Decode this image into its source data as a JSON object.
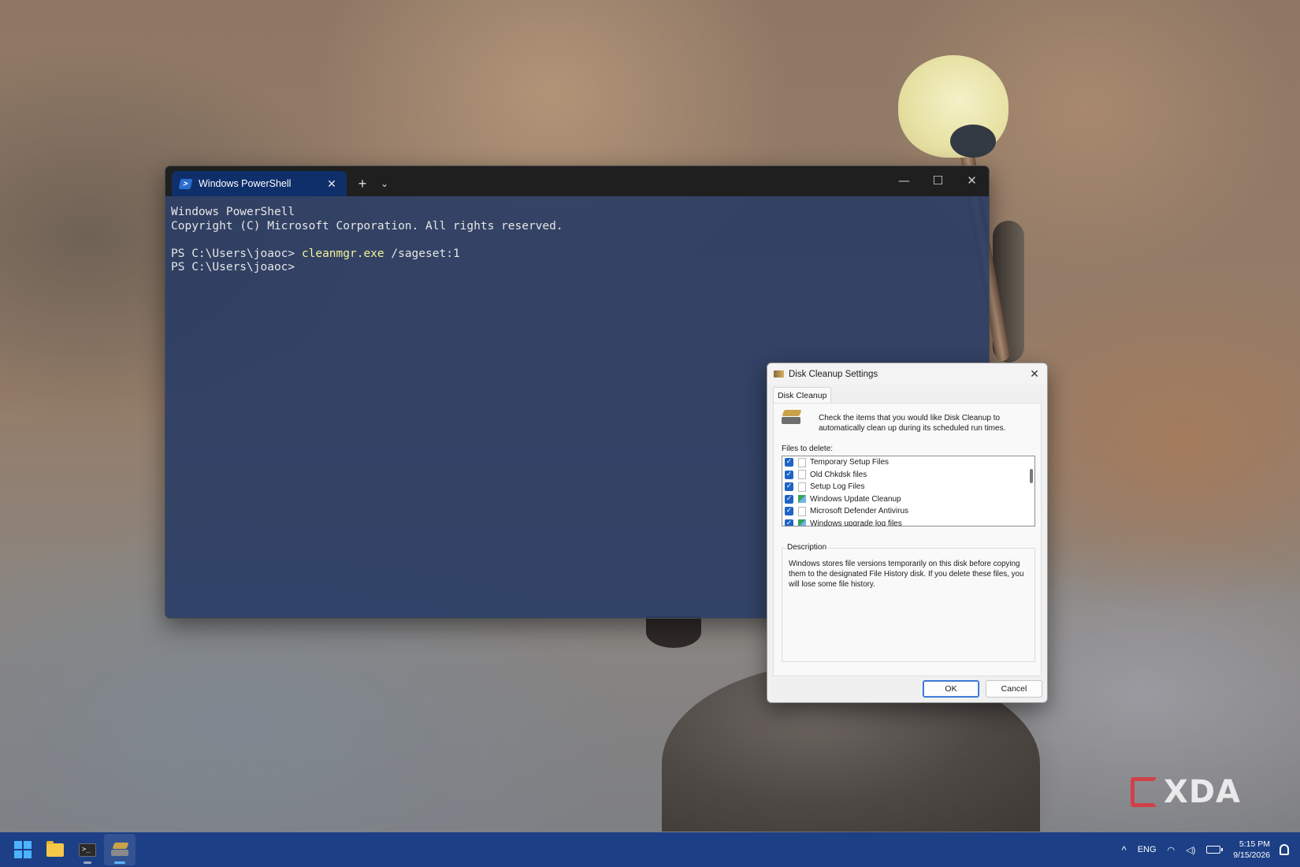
{
  "terminal": {
    "tab_title": "Windows PowerShell",
    "tab_close": "✕",
    "new_tab": "+",
    "dropdown": "⌄",
    "controls": {
      "minimize": "—",
      "maximize": "☐",
      "close": "✕"
    },
    "lines": {
      "l1": "Windows PowerShell",
      "l2": "Copyright (C) Microsoft Corporation. All rights reserved.",
      "prompt1": "PS C:\\Users\\joaoc> ",
      "cmd_name": "cleanmgr.exe",
      "cmd_args": " /sageset:1",
      "prompt2": "PS C:\\Users\\joaoc>"
    }
  },
  "dialog": {
    "title": "Disk Cleanup Settings",
    "close": "✕",
    "tab": "Disk Cleanup",
    "intro": "Check the items that you would like Disk Cleanup to automatically clean up during its scheduled run times.",
    "files_label": "Files to delete:",
    "files": [
      {
        "label": "Temporary Setup Files",
        "checked": true,
        "icon": "blank-file-icon"
      },
      {
        "label": "Old Chkdsk files",
        "checked": true,
        "icon": "blank-file-icon"
      },
      {
        "label": "Setup Log Files",
        "checked": true,
        "icon": "blank-file-icon"
      },
      {
        "label": "Windows Update Cleanup",
        "checked": true,
        "icon": "update-icon"
      },
      {
        "label": "Microsoft Defender Antivirus",
        "checked": true,
        "icon": "blank-file-icon"
      },
      {
        "label": "Windows upgrade log files",
        "checked": true,
        "icon": "update-icon"
      }
    ],
    "check_glyph": "✓",
    "description_label": "Description",
    "description": "Windows stores file versions temporarily on this disk before copying them to the designated File History disk. If you delete these files, you will lose some file history.",
    "ok": "OK",
    "cancel": "Cancel"
  },
  "taskbar": {
    "apps": [
      "start-icon",
      "file-explorer-icon",
      "terminal-icon",
      "disk-cleanup-icon"
    ],
    "terminal_glyph": ">_",
    "tray": {
      "chevron": "^",
      "language": "ENG",
      "wifi": "◠",
      "volume": "◁)",
      "time": "5:15 PM",
      "date": "9/15/2026"
    }
  },
  "watermark": {
    "text": "XDA"
  },
  "colors": {
    "terminal_tab": "#0f2f6a",
    "terminal_body": "#263a64",
    "command_highlight": "#f3f29a",
    "checkbox": "#1f63c6",
    "taskbar": "#1c3f86"
  }
}
